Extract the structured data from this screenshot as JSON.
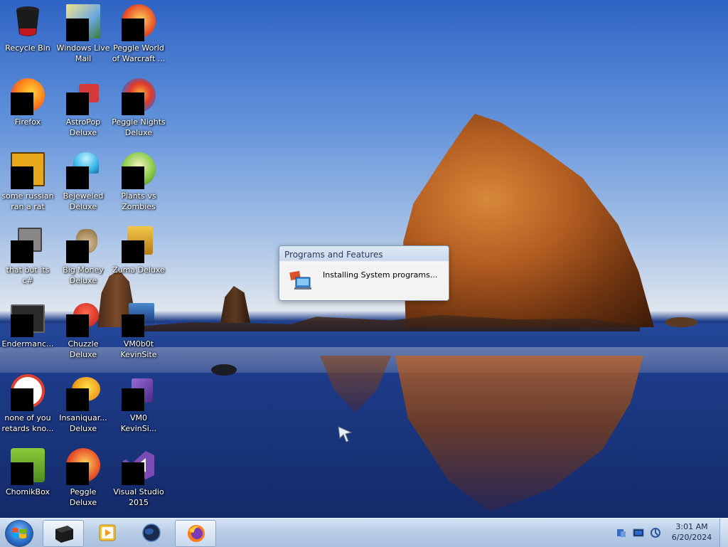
{
  "desktop_icons": [
    {
      "label": "Recycle Bin",
      "icon": "recycle-bin-icon",
      "color": "#c0181e"
    },
    {
      "label": "Windows Live\nMail",
      "icon": "mail-icon",
      "color": "#6aa8e0"
    },
    {
      "label": "Peggle World\nof Warcraft ...",
      "icon": "peggle-icon",
      "color": "#e8542a"
    },
    {
      "label": "Firefox",
      "icon": "firefox-icon",
      "color": "#ff7b1a"
    },
    {
      "label": "AstroPop\nDeluxe",
      "icon": "astropop-icon",
      "color": "#d33a3a"
    },
    {
      "label": "Peggle Nights\nDeluxe",
      "icon": "peggle-nights-icon",
      "color": "#3a6bd1"
    },
    {
      "label": "some russian\nran a rat",
      "icon": "app-icon",
      "color": "#e8a81c"
    },
    {
      "label": "Bejeweled\nDeluxe",
      "icon": "bejeweled-icon",
      "color": "#3ab7e8"
    },
    {
      "label": "Plants vs\nZombies",
      "icon": "plants-vs-zombies-icon",
      "color": "#4d9a36"
    },
    {
      "label": "that but its c#",
      "icon": "shortcut-icon",
      "color": "#7a7a7a"
    },
    {
      "label": "Big Money\nDeluxe",
      "icon": "money-bag-icon",
      "color": "#a08050"
    },
    {
      "label": "Zuma Deluxe",
      "icon": "zuma-icon",
      "color": "#d19a2a"
    },
    {
      "label": "Endermanc...",
      "icon": "console-icon",
      "color": "#333333"
    },
    {
      "label": "Chuzzle\nDeluxe",
      "icon": "chuzzle-icon",
      "color": "#d02020"
    },
    {
      "label": "VM0b0t\nKevinSite",
      "icon": "vm-icon",
      "color": "#2a5a9a"
    },
    {
      "label": "none of you\nretards kno...",
      "icon": "red-circle-icon",
      "color": "#e04030"
    },
    {
      "label": "Insaniquar...\nDeluxe",
      "icon": "fish-icon",
      "color": "#f0a020"
    },
    {
      "label": "VM0\nKevinSi...",
      "icon": "visual-studio-icon",
      "color": "#6a3aa0"
    },
    {
      "label": "ChomikBox",
      "icon": "hamster-icon",
      "color": "#7ab830"
    },
    {
      "label": "Peggle Deluxe",
      "icon": "peggle-deluxe-icon",
      "color": "#e8542a"
    },
    {
      "label": "Visual Studio\n2015",
      "icon": "visual-studio-icon",
      "color": "#7b4ab5"
    }
  ],
  "dialog": {
    "title": "Programs and Features",
    "message": "Installing System programs..."
  },
  "taskbar": {
    "items": [
      {
        "name": "black-app",
        "icon": "black-box-icon",
        "active": true
      },
      {
        "name": "media-player",
        "icon": "media-player-icon",
        "active": false
      },
      {
        "name": "globe-app",
        "icon": "globe-icon",
        "active": false
      },
      {
        "name": "firefox",
        "icon": "firefox-icon",
        "active": true
      }
    ],
    "tray_icons": [
      "network-icon",
      "display-icon",
      "system-icon"
    ],
    "clock_time": "3:01 AM",
    "clock_date": "6/20/2024"
  }
}
